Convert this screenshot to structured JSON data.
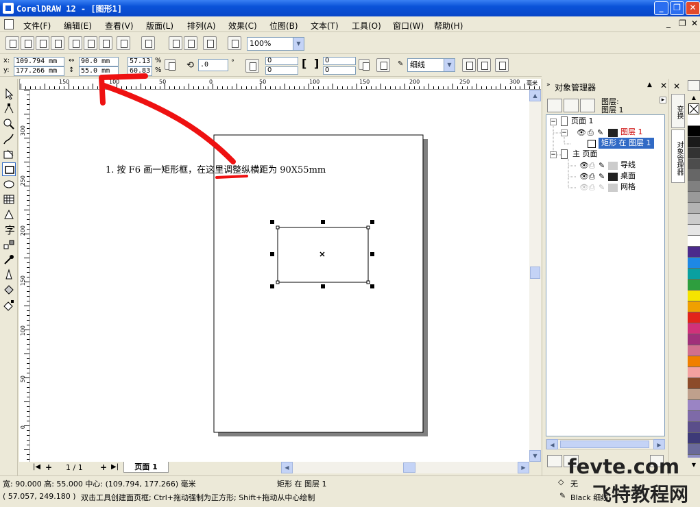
{
  "window": {
    "title": "CorelDRAW 12 - [图形1]"
  },
  "menu": [
    "文件(F)",
    "编辑(E)",
    "查看(V)",
    "版面(L)",
    "排列(A)",
    "效果(C)",
    "位图(B)",
    "文本(T)",
    "工具(O)",
    "窗口(W)",
    "帮助(H)"
  ],
  "toolbar": {
    "zoom": "100%"
  },
  "propbar": {
    "x_label": "x:",
    "y_label": "y:",
    "x": "109.794 mm",
    "y": "177.266 mm",
    "width": "90.0 mm",
    "height": "55.0 mm",
    "scale_w": "57.13",
    "scale_h": "60.83",
    "pct": "%",
    "rotation": ".0",
    "deg": "°",
    "corner_tl": "0",
    "corner_bl": "0",
    "corner_tr": "0",
    "corner_br": "0",
    "outline": "细线"
  },
  "ruler": {
    "unit": "毫米",
    "top_ticks": [
      "150",
      "100",
      "50",
      "0",
      "50",
      "100",
      "150",
      "200",
      "250",
      "300"
    ],
    "left_ticks": [
      "300",
      "250",
      "200",
      "150",
      "100",
      "50",
      "0"
    ]
  },
  "canvas": {
    "annotation": "1. 按 F6 画一矩形框，在这里调整纵横距为 90X55mm"
  },
  "pagenav": {
    "count": "1 / 1",
    "tab": "页面 1"
  },
  "docker": {
    "title": "对象管理器",
    "header_layer": "图层:",
    "header_name": "图层 1",
    "tree": [
      {
        "label": "页面 1"
      },
      {
        "label": "图层 1",
        "color": "#cc0000"
      },
      {
        "label": "矩形 在 图层 1",
        "selected": true
      },
      {
        "label": "主 页面"
      },
      {
        "label": "导线"
      },
      {
        "label": "桌面"
      },
      {
        "label": "网格"
      }
    ],
    "side_tabs": [
      "变换",
      "对象管理器"
    ]
  },
  "palette": [
    "#ffffff",
    "#000000",
    "#1a1a1a",
    "#333333",
    "#4d4d4d",
    "#666666",
    "#808080",
    "#999999",
    "#b3b3b3",
    "#cccccc",
    "#e6e6e6",
    "#ffffff",
    "#4b2a8c",
    "#1e88e5",
    "#0aa0a0",
    "#2e9e3e",
    "#f5e400",
    "#f0a000",
    "#e2231a",
    "#d1317a",
    "#a0307a",
    "#d16f8e",
    "#f07f00",
    "#f4a0a0",
    "#8c4b2a",
    "#bfa08c",
    "#9a84c4",
    "#7e6aa8",
    "#5a4e8a",
    "#3d3a78",
    "#6a6a9a",
    "#8e8ec4"
  ],
  "status": {
    "size": "宽: 90.000 高: 55.000 中心: (109.794, 177.266) 毫米",
    "object": "矩形 在 图层 1",
    "coords": "( 57.057, 249.180 )",
    "hint": "双击工具创建面页框; Ctrl+拖动强制为正方形; Shift+拖动从中心绘制",
    "fill": "无",
    "outline": "Black 细线"
  },
  "watermark": {
    "site": "fevte.com",
    "name": "飞特教程网"
  },
  "colors": {
    "titlebar": "#0a52d8",
    "arrow": "#ee1111",
    "selection": "#316ac5"
  }
}
